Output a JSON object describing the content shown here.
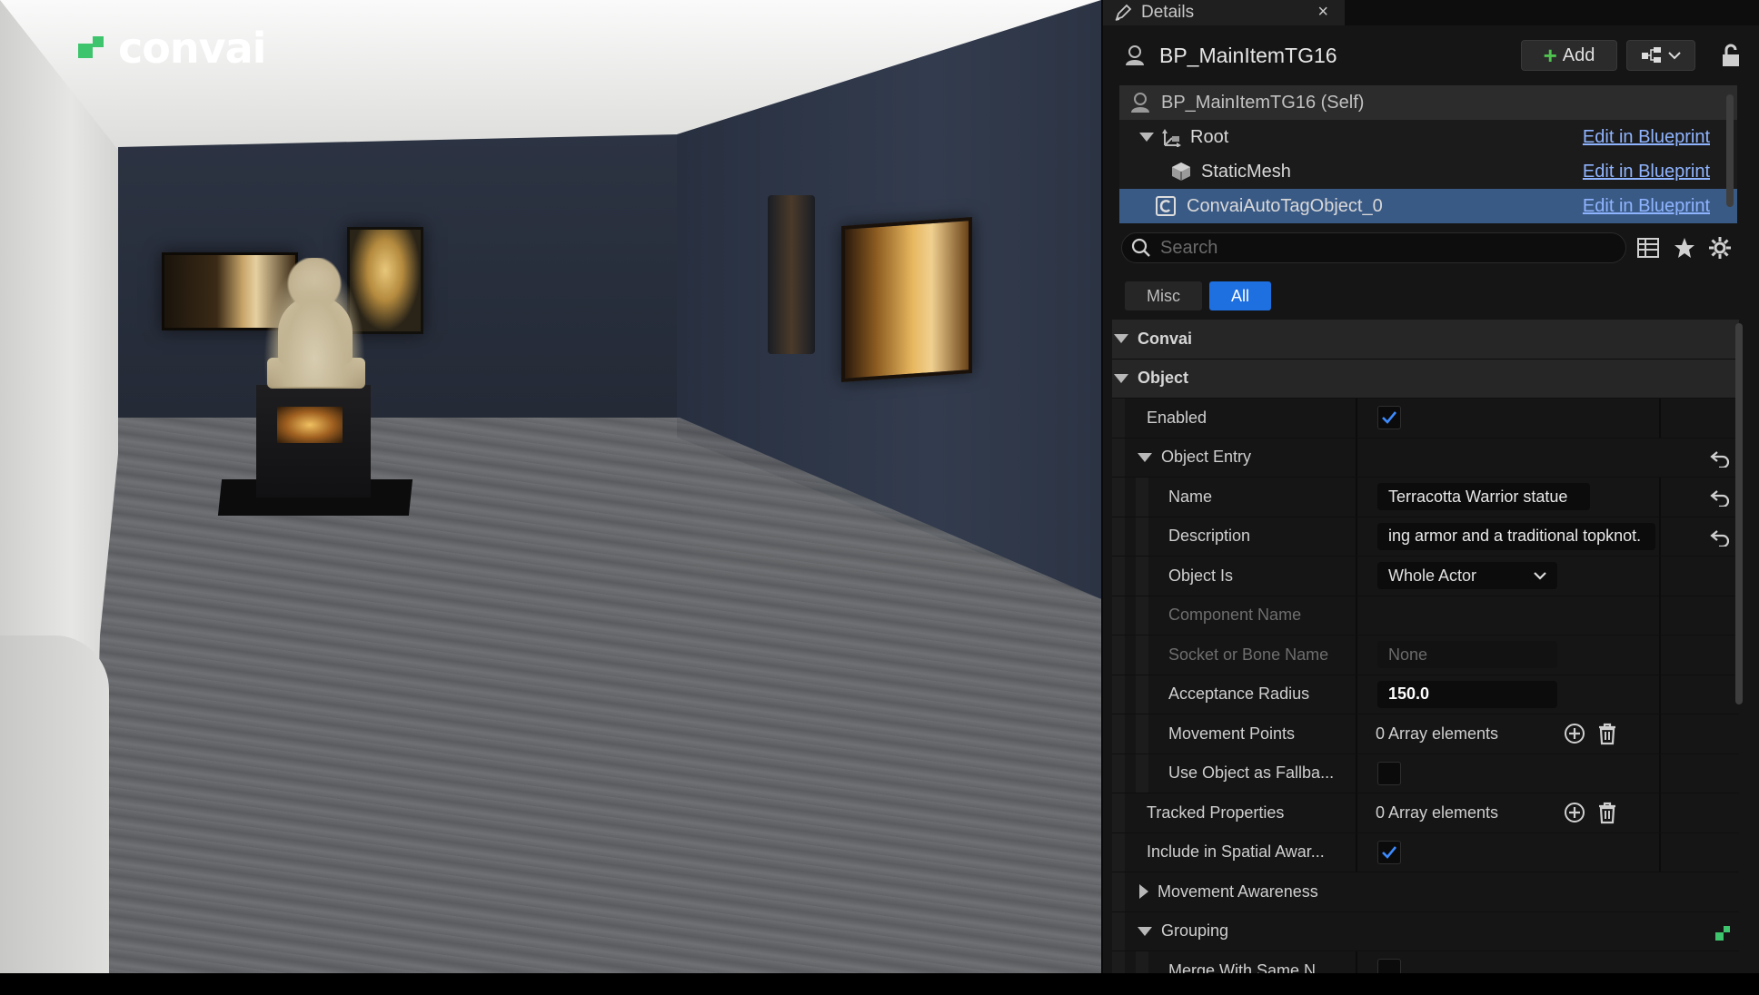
{
  "brand": {
    "logo_text": "convai",
    "accent": "#3ec46d"
  },
  "details_tab": {
    "title": "Details",
    "close_glyph": "×"
  },
  "actor": {
    "name": "BP_MainItemTG16",
    "add_label": "Add",
    "add_glyph": "+"
  },
  "components": [
    {
      "label": "BP_MainItemTG16 (Self)",
      "edit": ""
    },
    {
      "label": "Root",
      "edit": "Edit in Blueprint"
    },
    {
      "label": "StaticMesh",
      "edit": "Edit in Blueprint"
    },
    {
      "label": "ConvaiAutoTagObject_0",
      "edit": "Edit in Blueprint"
    }
  ],
  "search": {
    "placeholder": "Search"
  },
  "filters": {
    "misc": "Misc",
    "all": "All"
  },
  "sections": {
    "convai": "Convai",
    "object": "Object",
    "object_entry": "Object Entry",
    "movement_awareness": "Movement Awareness",
    "grouping": "Grouping"
  },
  "props": {
    "enabled": {
      "label": "Enabled",
      "checked": true
    },
    "name": {
      "label": "Name",
      "value": "Terracotta Warrior statue"
    },
    "description": {
      "label": "Description",
      "value": "ing armor and a traditional topknot."
    },
    "object_is": {
      "label": "Object Is",
      "value": "Whole Actor"
    },
    "component_name": {
      "label": "Component Name"
    },
    "socket": {
      "label": "Socket or Bone Name",
      "value": "None"
    },
    "acceptance_radius": {
      "label": "Acceptance Radius",
      "value": "150.0"
    },
    "movement_points": {
      "label": "Movement Points",
      "value": "0 Array elements"
    },
    "use_fallback": {
      "label": "Use Object as Fallba...",
      "checked": false
    },
    "tracked": {
      "label": "Tracked Properties",
      "value": "0 Array elements"
    },
    "spatial": {
      "label": "Include in Spatial Awar...",
      "checked": true
    },
    "merge": {
      "label": "Merge With Same N..."
    }
  }
}
